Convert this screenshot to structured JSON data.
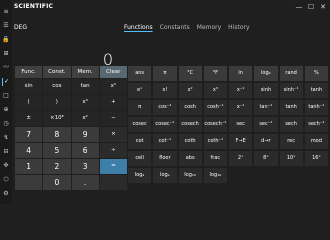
{
  "app": {
    "title": "SCIENTIFIC"
  },
  "mode": "DEG",
  "display": {
    "value": "0"
  },
  "tabs": [
    "Functions",
    "Constants",
    "Memory",
    "History"
  ],
  "window": {
    "minimize": "—",
    "maximize": "☐",
    "close": "✕"
  },
  "rail_icons": [
    "≡",
    "☰",
    "🔒",
    "⊞",
    "〰",
    "✓",
    "□",
    "⊕",
    "◷",
    "↯",
    "⊟",
    "✜",
    "⬡",
    "⚙"
  ],
  "keypad": {
    "top": [
      "Func.",
      "Const.",
      "Mem.",
      "Clear"
    ],
    "rows": [
      [
        "sin",
        "cos",
        "tan",
        "x²"
      ],
      [
        "(",
        ")",
        "x³",
        "+"
      ],
      [
        "±",
        "×10ᴱ",
        "x²",
        "−"
      ],
      [
        "7",
        "8",
        "9",
        "×"
      ],
      [
        "4",
        "5",
        "6",
        "÷"
      ],
      [
        "1",
        "2",
        "3",
        "="
      ],
      [
        "",
        "0",
        ".",
        ""
      ]
    ]
  },
  "functions": [
    [
      "ans",
      "π",
      "°C",
      "°F",
      "in",
      "log₂",
      "rand",
      "%"
    ],
    [
      "eˣ",
      "x!",
      "x²",
      "x³",
      "x⁻¹",
      "sinh",
      "sinh⁻¹",
      "tanh"
    ],
    [
      "π",
      "cos⁻¹",
      "cosh",
      "cosh⁻¹",
      "x⁻¹",
      "tan⁻¹",
      "tanh",
      "tanh⁻¹"
    ],
    [
      "cosec",
      "cosec⁻¹",
      "cosech",
      "cosech⁻¹",
      "sec",
      "sec⁻¹",
      "sech",
      "sech⁻¹"
    ],
    [
      "cot",
      "cot⁻¹",
      "coth",
      "coth⁻¹",
      "F→E",
      "d→r",
      "rec",
      "mod"
    ],
    [
      "cell",
      "floor",
      "abs",
      "frac",
      "2ˣ",
      "8ˣ",
      "10ˣ",
      "16ˣ"
    ],
    [
      "log₂",
      "logₑ",
      "log₁₀",
      "log₁₆",
      "",
      "",
      "",
      ""
    ]
  ],
  "colors": {
    "bg": "#1f1f1f",
    "accent": "#4cc2ff",
    "equals": "#3d7fa8"
  }
}
